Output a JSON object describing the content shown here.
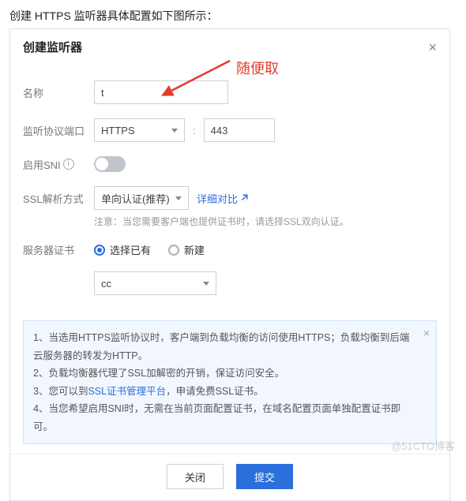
{
  "page_heading": "创建 HTTPS 监听器具体配置如下图所示：",
  "dialog": {
    "title": "创建监听器",
    "close_glyph": "×"
  },
  "annotation": {
    "text": "随便取"
  },
  "form": {
    "name": {
      "label": "名称",
      "value": "t"
    },
    "port": {
      "label": "监听协议端口",
      "protocol_value": "HTTPS",
      "separator": ":",
      "port_value": "443"
    },
    "sni": {
      "label": "启用SNI"
    },
    "ssl_mode": {
      "label": "SSL解析方式",
      "value": "单向认证(推荐)",
      "compare_link": "详细对比",
      "note": "注意：当您需要客户端也提供证书时，请选择SSL双向认证。"
    },
    "server_cert": {
      "label": "服务器证书",
      "option_existing": "选择已有",
      "option_new": "新建",
      "cert_value": "cc"
    }
  },
  "notice": {
    "items": [
      "1、当选用HTTPS监听协议时，客户端到负载均衡的访问使用HTTPS；负载均衡到后端云服务器的转发为HTTP。",
      "2、负载均衡器代理了SSL加解密的开销，保证访问安全。",
      "3、您可以到",
      "SSL证书管理平台",
      "，申请免费SSL证书。",
      "4、当您希望启用SNI时，无需在当前页面配置证书，在域名配置页面单独配置证书即可。"
    ]
  },
  "footer": {
    "close": "关闭",
    "submit": "提交"
  },
  "watermark": "@51CTO博客"
}
